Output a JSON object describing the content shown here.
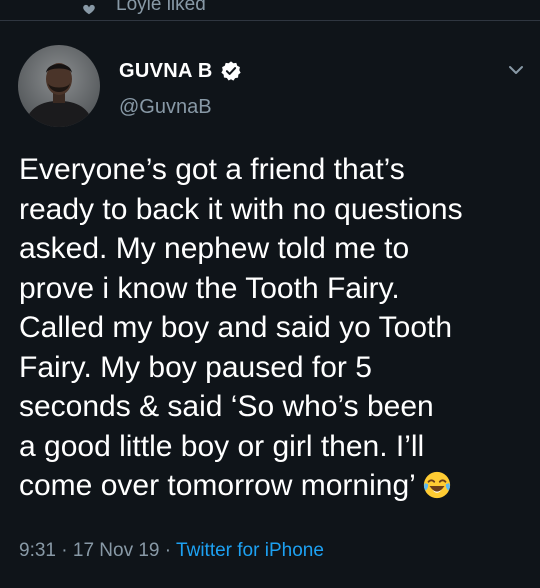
{
  "social_context": {
    "text": "Loyle liked",
    "icon": "heart-icon"
  },
  "author": {
    "display_name": "GUVNA B",
    "handle": "@GuvnaB",
    "verified_icon": "verified-badge-icon",
    "avatar": "avatar"
  },
  "menu": {
    "icon": "chevron-down-icon"
  },
  "tweet": {
    "lines": [
      "Everyone’s got a friend that’s",
      "ready to back it with no questions",
      "asked. My nephew told me to",
      "prove i know the Tooth Fairy.",
      "Called my boy and said yo Tooth",
      "Fairy. My boy paused for 5",
      "seconds & said ‘So who’s been",
      "a good little boy or girl then. I’ll",
      "come over tomorrow morning’"
    ],
    "emoji": "face-with-tears-of-joy-icon"
  },
  "meta": {
    "time": "9:31",
    "separator": " · ",
    "date": "17 Nov 19",
    "source": "Twitter for iPhone"
  },
  "colors": {
    "background": "#0f1419",
    "text": "#ffffff",
    "muted": "#8899a6",
    "accent": "#1da1f2"
  }
}
